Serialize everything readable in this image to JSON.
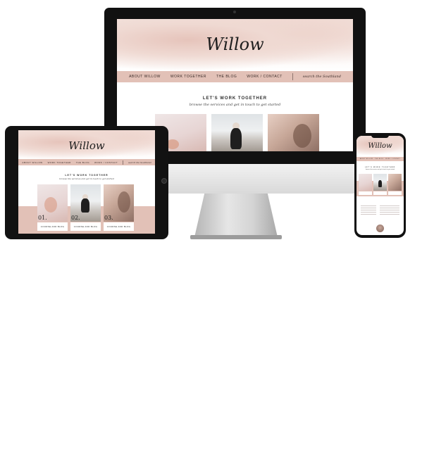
{
  "site": {
    "logo": "Willow",
    "nav": [
      "ABOUT WILLOW",
      "WORK TOGETHER",
      "THE BLOG",
      "WORK / CONTACT"
    ],
    "search_placeholder": "search the Southland",
    "headline": "LET'S WORK TOGETHER",
    "subline": "browse the services and get in touch to get started",
    "cards": [
      {
        "number": "01.",
        "button": "COURSE AND BLOG",
        "photo": "hands-photo"
      },
      {
        "number": "02.",
        "button": "COURSE AND BLOG",
        "photo": "beach-photo"
      },
      {
        "number": "03.",
        "button": "COURSE AND BLOG",
        "photo": "portrait-photo"
      }
    ]
  },
  "colors": {
    "accent": "#e2c1b7",
    "wash": "#efd9d2",
    "frame": "#111111",
    "text": "#2b2b2b"
  }
}
